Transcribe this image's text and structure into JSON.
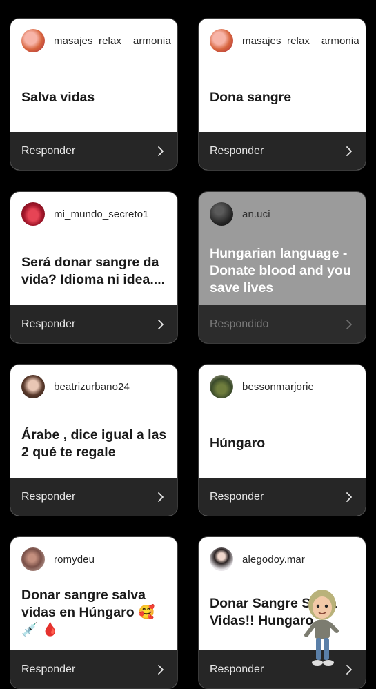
{
  "cards": [
    {
      "username": "masajes_relax__armonia",
      "question": "Salva vidas",
      "action": "Responder",
      "answered": false,
      "avatar": "masajes-avatar"
    },
    {
      "username": "masajes_relax__armonia",
      "question": "Dona sangre",
      "action": "Responder",
      "answered": false,
      "avatar": "masajes-avatar"
    },
    {
      "username": "mi_mundo_secreto1",
      "question": "Será donar sangre da vida? Idioma ni idea....",
      "action": "Responder",
      "answered": false,
      "avatar": "lips-avatar"
    },
    {
      "username": "an.uci",
      "question": "Hungarian language - Donate blood and you save lives",
      "action": "Respondido",
      "answered": true,
      "avatar": "dark-avatar"
    },
    {
      "username": "beatrizurbano24",
      "question": "Árabe , dice igual a las 2 qué te regale",
      "action": "Responder",
      "answered": false,
      "avatar": "portrait-avatar"
    },
    {
      "username": "bessonmarjorie",
      "question": "Húngaro",
      "action": "Responder",
      "answered": false,
      "avatar": "landscape-avatar"
    },
    {
      "username": "romydeu",
      "question": "Donar sangre salva vidas en Húngaro 🥰 💉 🩸",
      "action": "Responder",
      "answered": false,
      "avatar": "couple-avatar"
    },
    {
      "username": "alegodoy.mar",
      "question": "Donar Sangre Salva Vidas!! Hungaro",
      "action": "Responder",
      "answered": false,
      "avatar": "woman-avatar"
    }
  ]
}
